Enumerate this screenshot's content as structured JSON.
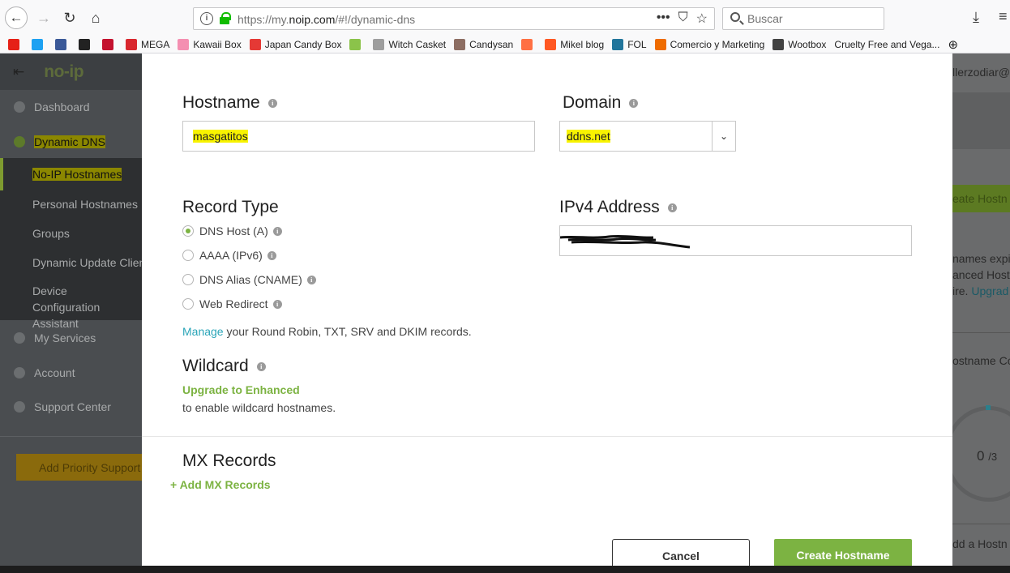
{
  "browser": {
    "url_prefix": "https://my.",
    "url_domain": "noip.com",
    "url_suffix": "/#!/dynamic-dns",
    "url_actions": [
      "•••",
      "⛉",
      "☆"
    ],
    "search_placeholder": "Buscar",
    "bookmarks": [
      {
        "label": "",
        "icon": "youtube-icon",
        "color": "#e62117"
      },
      {
        "label": "",
        "icon": "twitter-icon",
        "color": "#1da1f2"
      },
      {
        "label": "",
        "icon": "facebook-icon",
        "color": "#3b5998"
      },
      {
        "label": "",
        "icon": "amazon-icon",
        "color": "#222222"
      },
      {
        "label": "",
        "icon": "gift-icon",
        "color": "#c4122f"
      },
      {
        "label": "MEGA",
        "icon": "mega-icon",
        "color": "#d9272e"
      },
      {
        "label": "Kawaii Box",
        "icon": "heart-icon",
        "color": "#f48fb1"
      },
      {
        "label": "Japan Candy Box",
        "icon": "candy-icon",
        "color": "#e53935"
      },
      {
        "label": "",
        "icon": "ys-icon",
        "color": "#8bc34a"
      },
      {
        "label": "Witch Casket",
        "icon": "casket-icon",
        "color": "#9e9e9e"
      },
      {
        "label": "Candysan",
        "icon": "candysan-icon",
        "color": "#8d6e63"
      },
      {
        "label": "",
        "icon": "sushi-icon",
        "color": "#ff7043"
      },
      {
        "label": "Mikel blog",
        "icon": "blogger-icon",
        "color": "#ff5722"
      },
      {
        "label": "FOL",
        "icon": "wordpress-icon",
        "color": "#21759b"
      },
      {
        "label": "Comercio y Marketing",
        "icon": "commerce-icon",
        "color": "#ef6c00"
      },
      {
        "label": "Wootbox",
        "icon": "wootbox-icon",
        "color": "#424242"
      },
      {
        "label": "Cruelty Free and Vega...",
        "icon": "",
        "color": ""
      }
    ]
  },
  "sidebar": {
    "logo": "no-ip",
    "items": [
      {
        "label": "Dashboard",
        "icon": "dashboard-icon"
      },
      {
        "label": "Dynamic DNS",
        "icon": "globe-icon"
      },
      {
        "label": "My Services",
        "icon": "gear-icon"
      },
      {
        "label": "Account",
        "icon": "user-icon"
      },
      {
        "label": "Support Center",
        "icon": "lifebuoy-icon"
      }
    ],
    "sub_items": [
      "No-IP Hostnames",
      "Personal Hostnames",
      "Groups",
      "Dynamic Update Client",
      "Device Configuration Assistant"
    ],
    "priority_button": "Add Priority Support"
  },
  "background": {
    "user_text": "llerzodiar@",
    "create_btn_partial": "eate Hostn",
    "notice_line1": "names expi",
    "notice_line2": "anced Host",
    "notice_line3": "ire.",
    "notice_link": "Upgrad",
    "hostname_count_label": "ostname Co",
    "counter_value": "0",
    "counter_total": "/3",
    "add_host_partial": "dd a Hostn"
  },
  "modal": {
    "hostname_label": "Hostname",
    "hostname_value": "masgatitos",
    "domain_label": "Domain",
    "domain_value": "ddns.net",
    "record_type_label": "Record Type",
    "record_types": [
      "DNS Host (A)",
      "AAAA (IPv6)",
      "DNS Alias (CNAME)",
      "Web Redirect"
    ],
    "selected_record_type": "DNS Host (A)",
    "ipv4_label": "IPv4 Address",
    "manage_link": "Manage",
    "manage_text": " your Round Robin, TXT, SRV and DKIM records.",
    "wildcard_label": "Wildcard",
    "wildcard_upgrade": "Upgrade to Enhanced",
    "wildcard_text": "to enable wildcard hostnames.",
    "mx_label": "MX Records",
    "add_mx": "Add MX Records",
    "cancel_button": "Cancel",
    "create_button": "Create Hostname"
  },
  "colors": {
    "accent_green": "#7cb342",
    "link_teal": "#2aa5b8",
    "highlight_yellow": "#f8f300"
  }
}
